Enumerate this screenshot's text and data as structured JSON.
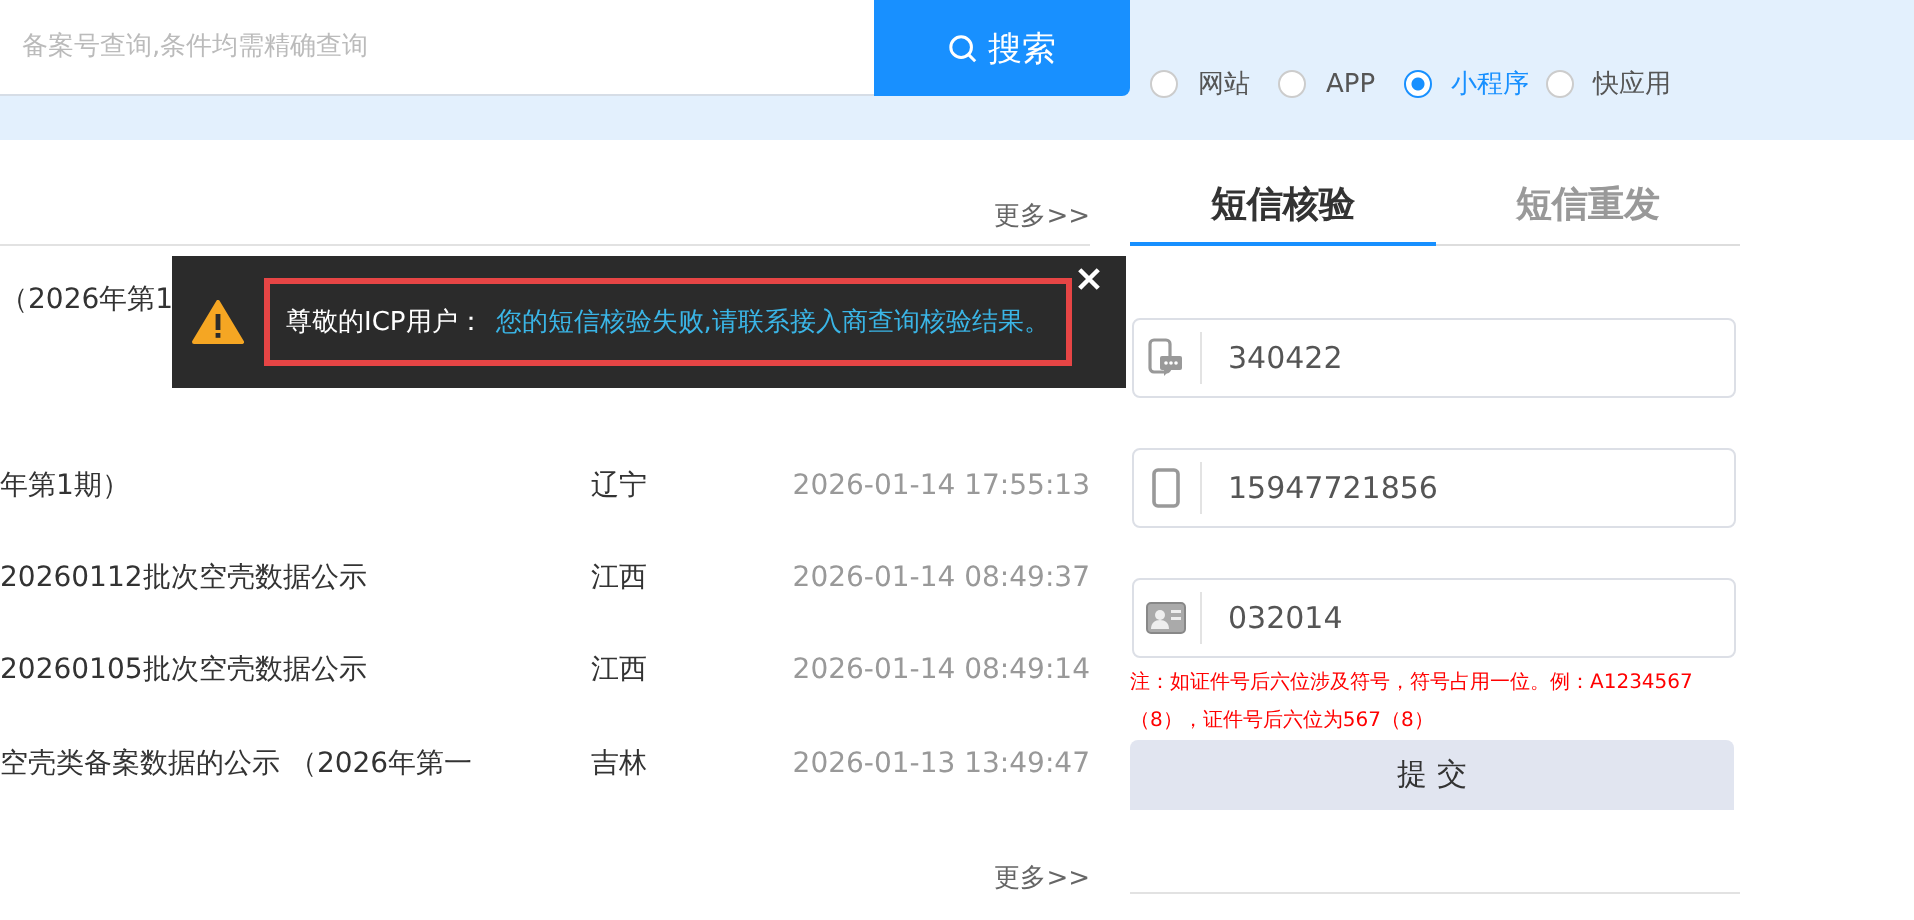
{
  "search": {
    "placeholder": "备案号查询,条件均需精确查询",
    "button": "搜索"
  },
  "filters": [
    {
      "label": "网站",
      "selected": false
    },
    {
      "label": "APP",
      "selected": false
    },
    {
      "label": "小程序",
      "selected": true
    },
    {
      "label": "快应用",
      "selected": false
    }
  ],
  "list": {
    "more_top": "更多>>",
    "rows": [
      {
        "title": "（2026年第1"
      },
      {},
      {
        "title": "年第1期）",
        "province": "辽宁",
        "time": "2026-01-14 17:55:13"
      },
      {
        "title": "20260112批次空壳数据公示",
        "province": "江西",
        "time": "2026-01-14 08:49:37"
      },
      {
        "title": "20260105批次空壳数据公示",
        "province": "江西",
        "time": "2026-01-14 08:49:14"
      },
      {
        "title": "空壳类备案数据的公示 （2026年第一",
        "province": "吉林",
        "time": "2026-01-13 13:49:47"
      }
    ],
    "more_bottom": "更多>>"
  },
  "tabs": [
    {
      "label": "短信核验",
      "selected": true
    },
    {
      "label": "短信重发",
      "selected": false
    }
  ],
  "fields": [
    {
      "kind": "sms",
      "value": "340422"
    },
    {
      "kind": "phone",
      "value": "15947721856"
    },
    {
      "kind": "id",
      "value": "032014"
    }
  ],
  "note": "注：如证件号后六位涉及符号，符号占用一位。例：A1234567（8），证件号后六位为567（8）",
  "submit": "提 交",
  "toast": {
    "greeting": "尊敬的ICP用户：",
    "message": "您的短信核验失败,请联系接入商查询核验结果。"
  }
}
